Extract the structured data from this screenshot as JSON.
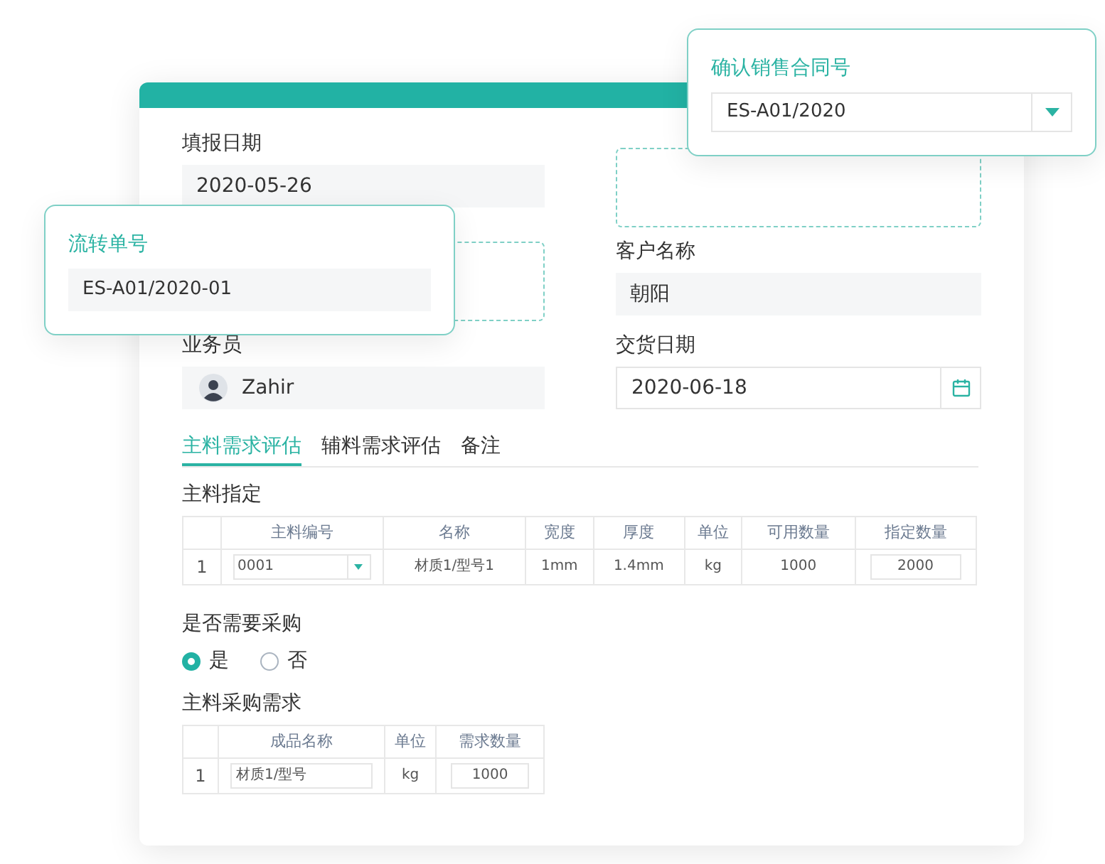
{
  "form": {
    "fields": [
      {
        "label": "填报日期",
        "value": "2020-05-26",
        "kind": "text"
      },
      {
        "label": "客户名称",
        "value": "朝阳",
        "kind": "text"
      },
      {
        "label": "业务员",
        "value": "Zahir",
        "kind": "person"
      },
      {
        "label": "交货日期",
        "value": "2020-06-18",
        "kind": "date"
      }
    ]
  },
  "tabs": [
    {
      "label": "主料需求评估",
      "selected": true
    },
    {
      "label": "辅料需求评估",
      "selected": false
    },
    {
      "label": "备注",
      "selected": false
    }
  ],
  "main_material": {
    "title": "主料指定",
    "columns": [
      "主料编号",
      "名称",
      "宽度",
      "厚度",
      "单位",
      "可用数量",
      "指定数量"
    ],
    "rows": [
      {
        "index": "1",
        "code": "0001",
        "name": "材质1/型号1",
        "width": "1mm",
        "thickness": "1.4mm",
        "unit": "kg",
        "available": "1000",
        "assigned": "2000"
      }
    ]
  },
  "purchase": {
    "question": "是否需要采购",
    "options": [
      {
        "label": "是",
        "selected": true
      },
      {
        "label": "否",
        "selected": false
      }
    ]
  },
  "purchase_demand": {
    "title": "主料采购需求",
    "columns": [
      "成品名称",
      "单位",
      "需求数量"
    ],
    "rows": [
      {
        "index": "1",
        "product": "材质1/型号",
        "unit": "kg",
        "quantity": "1000"
      }
    ]
  },
  "popups": [
    {
      "title": "流转单号",
      "value": "ES-A01/2020-01",
      "kind": "text"
    },
    {
      "title": "确认销售合同号",
      "value": "ES-A01/2020",
      "kind": "select"
    }
  ]
}
